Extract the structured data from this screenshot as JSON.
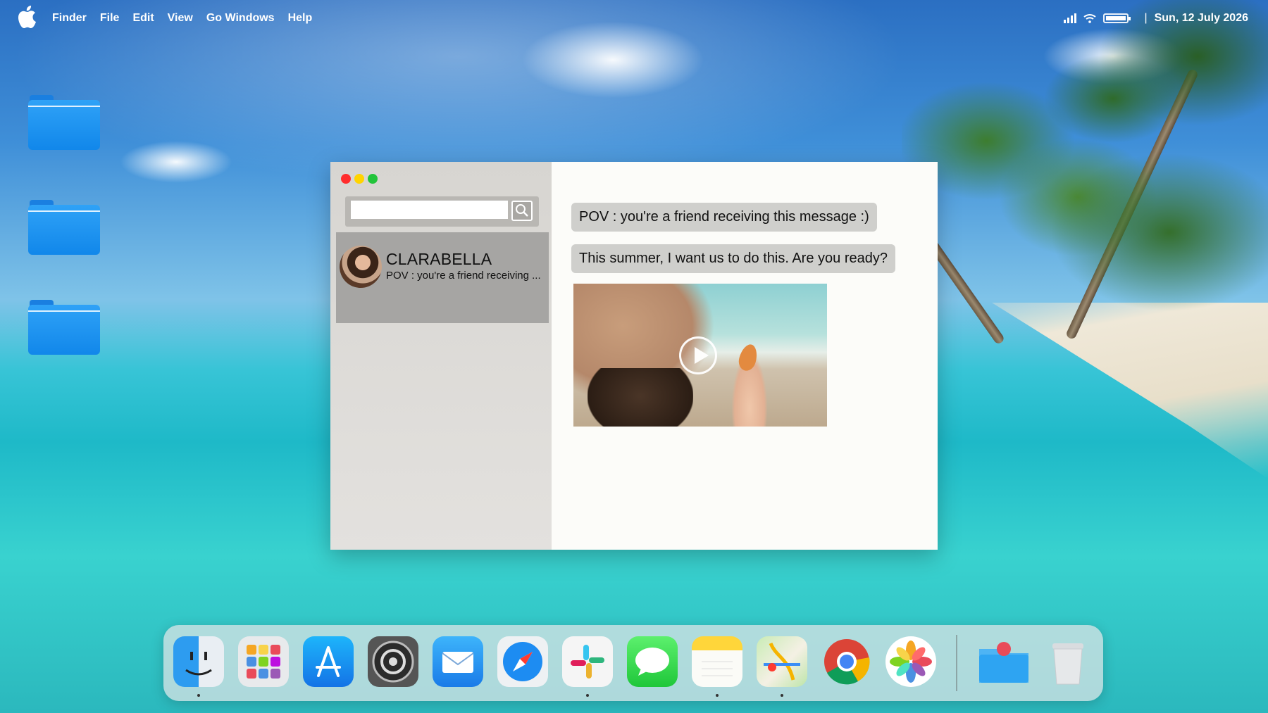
{
  "menubar": {
    "apple": "apple-logo",
    "items": [
      "Finder",
      "File",
      "Edit",
      "View",
      "Go Windows",
      "Help"
    ],
    "datetime": "Sun, 12 July 2026",
    "separator": "|"
  },
  "desktop": {
    "folders": [
      "folder",
      "folder",
      "folder"
    ]
  },
  "messages_app": {
    "search": {
      "value": "",
      "placeholder": ""
    },
    "conversations": [
      {
        "name": "CLARABELLA",
        "preview": "POV : you're a friend receiving ..."
      }
    ],
    "chat": [
      {
        "type": "text",
        "text": "POV : you're a friend receiving this message  :)"
      },
      {
        "type": "text",
        "text": "This summer, I want us to do this. Are you ready?"
      },
      {
        "type": "video",
        "icon": "play-icon"
      }
    ]
  },
  "dock": {
    "apps": [
      "Finder",
      "Launchpad",
      "App Store",
      "System Settings",
      "Mail",
      "Safari",
      "Slack",
      "Messages",
      "Notes",
      "Maps",
      "Chrome",
      "Photos",
      "Downloads",
      "Trash"
    ]
  },
  "colors": {
    "traffic_red": "#ff2d2d",
    "traffic_yellow": "#ffd400",
    "traffic_green": "#22c43a",
    "bubble": "#cfcfcc",
    "sidebar": "#d9d7d3",
    "selected_contact": "#a6a5a3"
  }
}
